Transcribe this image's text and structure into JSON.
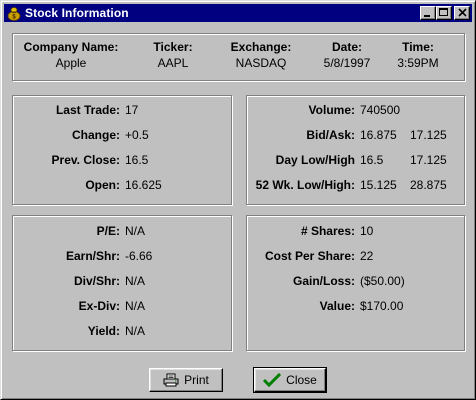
{
  "window": {
    "title": "Stock Information"
  },
  "header": {
    "company_label": "Company Name:",
    "company_value": "Apple",
    "ticker_label": "Ticker:",
    "ticker_value": "AAPL",
    "exchange_label": "Exchange:",
    "exchange_value": "NASDAQ",
    "date_label": "Date:",
    "date_value": "5/8/1997",
    "time_label": "Time:",
    "time_value": "3:59PM"
  },
  "trade": {
    "last_trade_label": "Last Trade:",
    "last_trade_value": "17",
    "change_label": "Change:",
    "change_value": "+0.5",
    "prev_close_label": "Prev. Close:",
    "prev_close_value": "16.5",
    "open_label": "Open:",
    "open_value": "16.625"
  },
  "volume": {
    "volume_label": "Volume:",
    "volume_value": "740500",
    "bidask_label": "Bid/Ask:",
    "bid_value": "16.875",
    "ask_value": "17.125",
    "day_label": "Day Low/High",
    "day_low": "16.5",
    "day_high": "17.125",
    "wk52_label": "52 Wk. Low/High:",
    "wk52_low": "15.125",
    "wk52_high": "28.875"
  },
  "fundamentals": {
    "pe_label": "P/E:",
    "pe_value": "N/A",
    "earn_label": "Earn/Shr:",
    "earn_value": "-6.66",
    "div_label": "Div/Shr:",
    "div_value": "N/A",
    "exdiv_label": "Ex-Div:",
    "exdiv_value": "N/A",
    "yield_label": "Yield:",
    "yield_value": "N/A"
  },
  "holding": {
    "shares_label": "# Shares:",
    "shares_value": "10",
    "cost_label": "Cost Per Share:",
    "cost_value": "22",
    "gain_label": "Gain/Loss:",
    "gain_value": "($50.00)",
    "value_label": "Value:",
    "value_value": "$170.00"
  },
  "buttons": {
    "print": "Print",
    "close": "Close"
  },
  "icons": {
    "app": "money-bag-icon",
    "minimize": "minimize-icon",
    "maximize": "maximize-icon",
    "close": "close-icon",
    "print": "printer-icon",
    "check": "checkmark-icon"
  },
  "colors": {
    "titlebar": "#000080",
    "face": "#c0c0c0",
    "check": "#008000"
  }
}
